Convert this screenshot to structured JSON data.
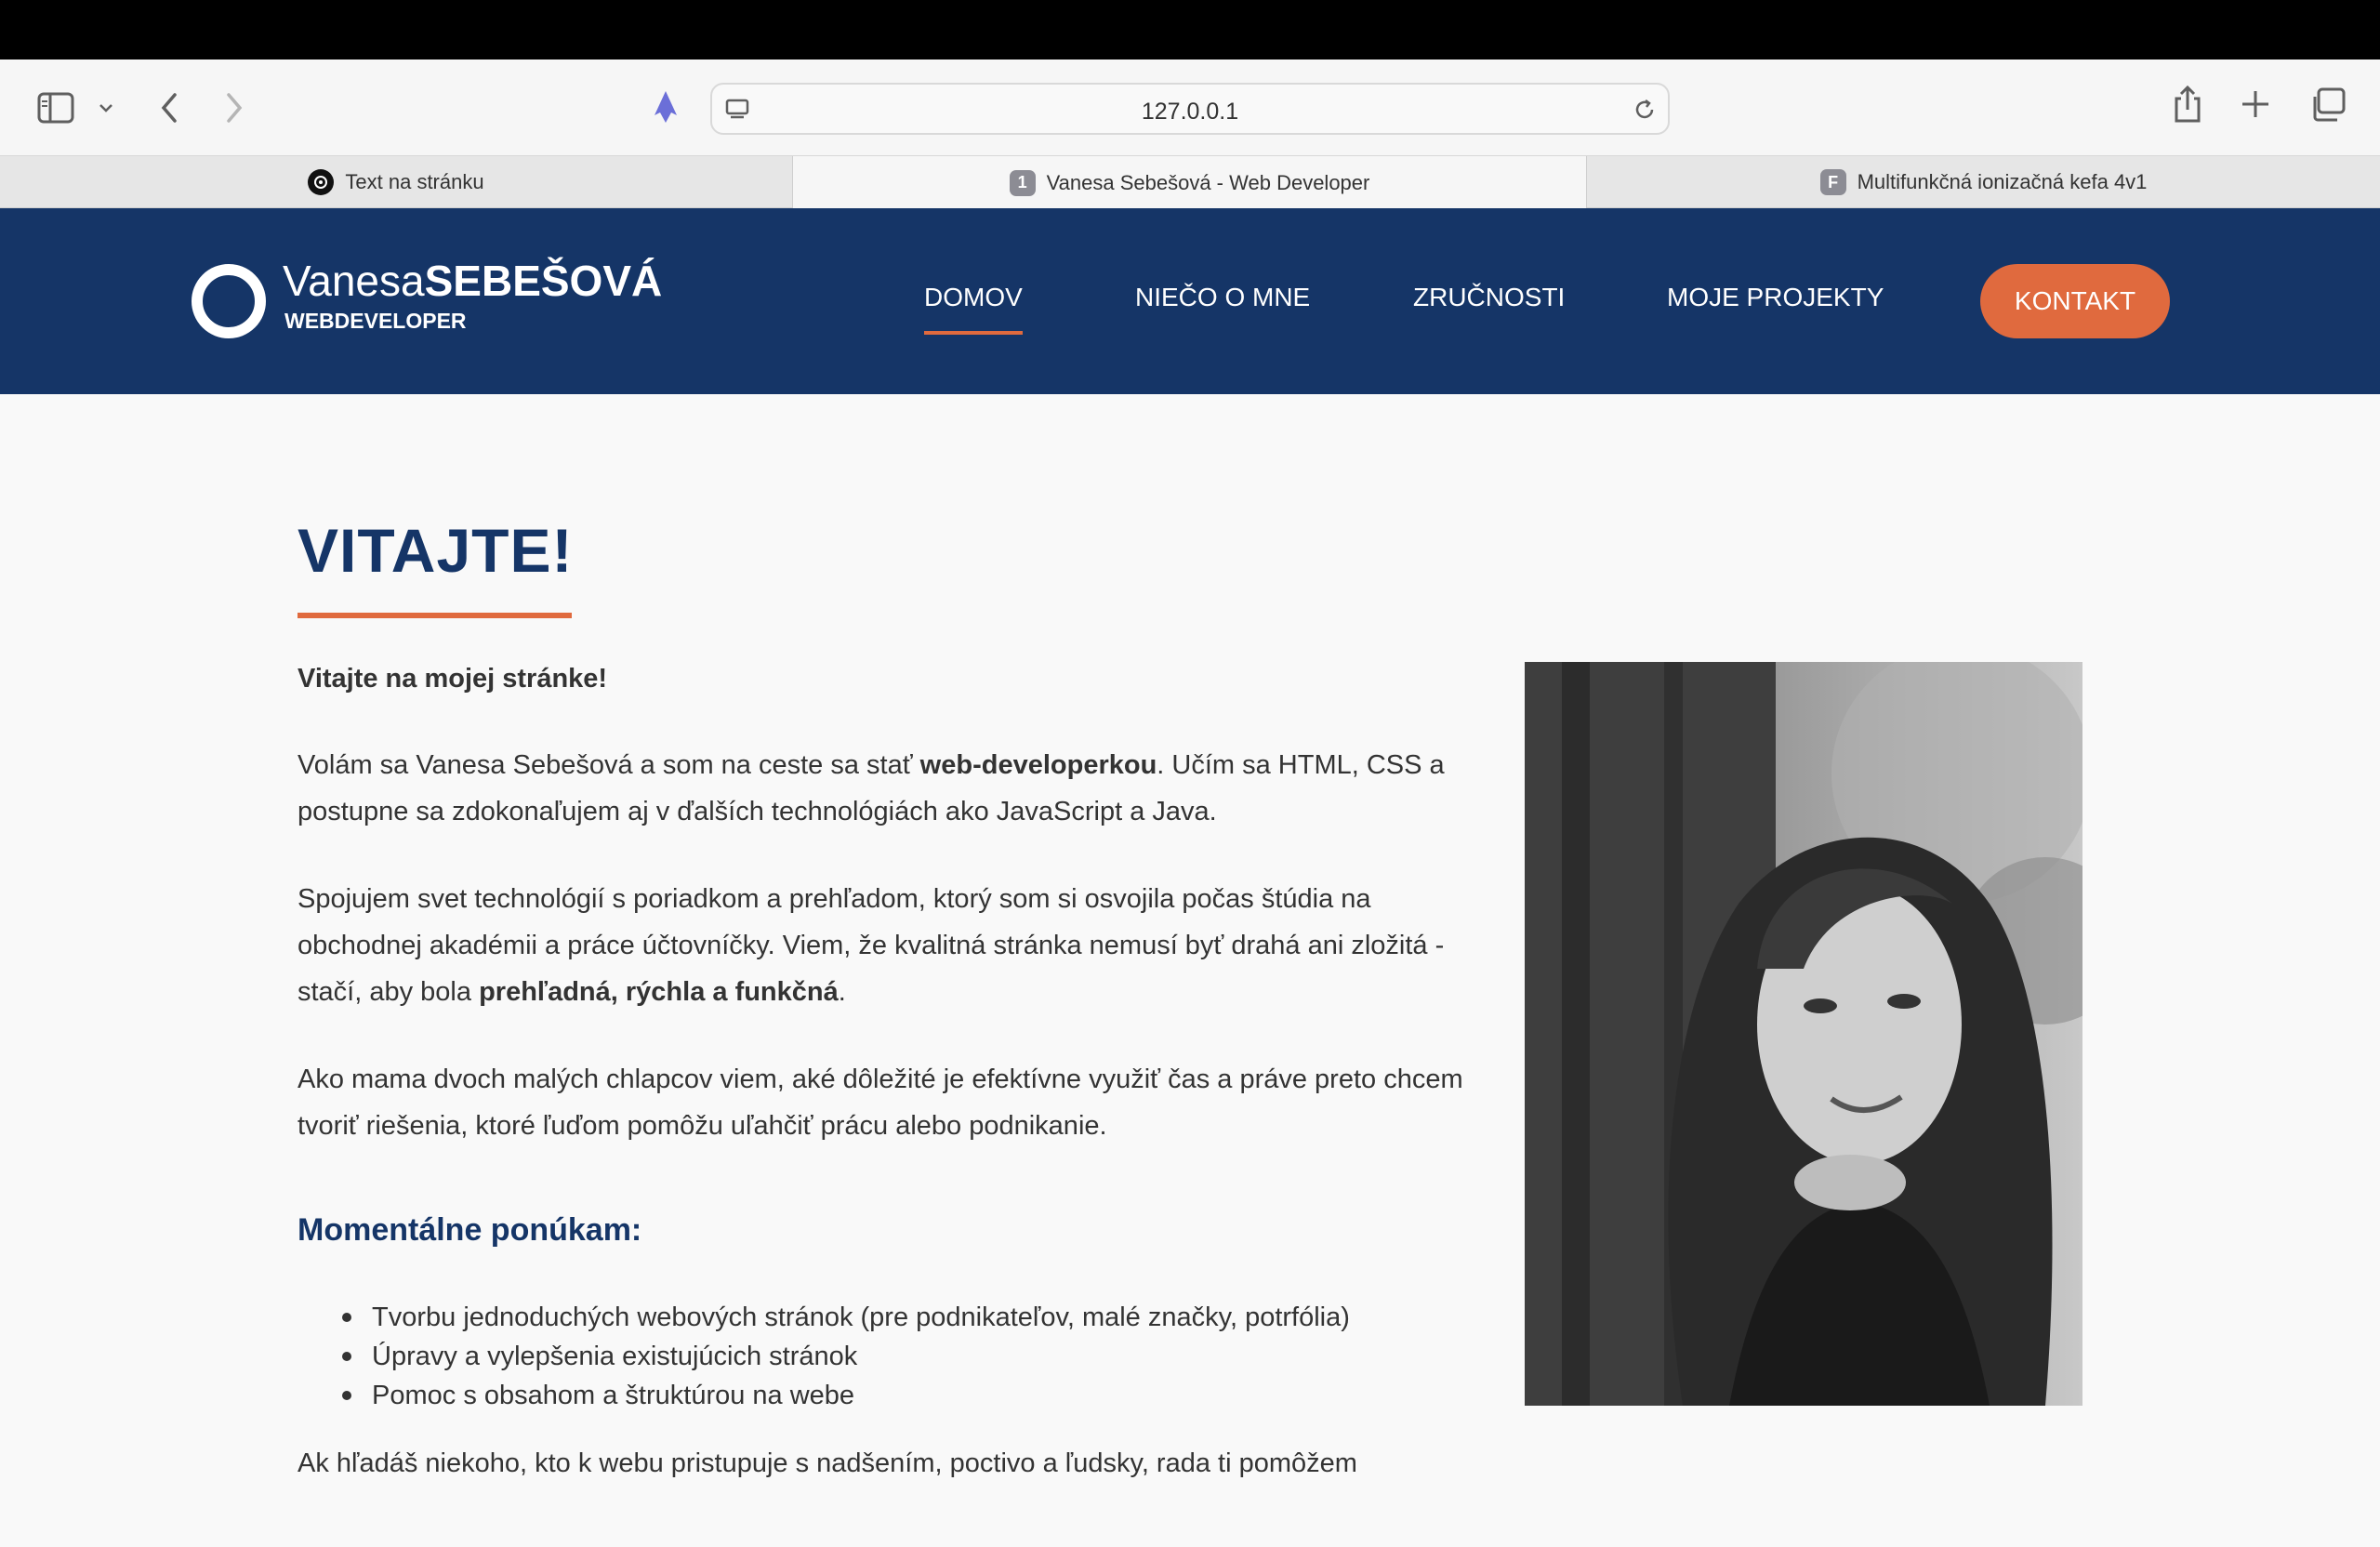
{
  "browser": {
    "url": "127.0.0.1",
    "tabs": [
      {
        "label": "Text na stránku",
        "favicon": "openai-icon"
      },
      {
        "label": "Vanesa Sebešová - Web Developer",
        "favicon_letter": "1"
      },
      {
        "label": "Multifunkčná ionizačná kefa 4v1",
        "favicon_letter": "F"
      }
    ]
  },
  "header": {
    "logo_first": "Vanesa",
    "logo_last": "SEBEŠOVÁ",
    "logo_sub": "WEBDEVELOPER",
    "nav": [
      "DOMOV",
      "NIEČO O MNE",
      "ZRUČNOSTI",
      "MOJE PROJEKTY"
    ],
    "cta": "KONTAKT"
  },
  "main": {
    "title": "VITAJTE!",
    "intro": "Vitajte na mojej stránke!",
    "p1_a": "Volám sa Vanesa Sebešová a som na ceste sa stať ",
    "p1_b": "web-developerkou",
    "p1_c": ". Učím sa HTML, CSS a postupne sa zdokonaľujem aj v ďalších technológiách ako JavaScript a Java.",
    "p2_a": "Spojujem svet technológií s poriadkom a prehľadom, ktorý som si osvojila počas štúdia na obchodnej akadémii a práce účtovníčky. Viem, že kvalitná stránka nemusí byť drahá ani zložitá - stačí, aby bola ",
    "p2_b": "prehľadná, rýchla a funkčná",
    "p2_c": ".",
    "p3": "Ako mama dvoch malých chlapcov viem, aké dôležité je efektívne využiť čas a práve preto chcem tvoriť riešenia, ktoré ľuďom pomôžu uľahčiť prácu alebo podnikanie.",
    "offer_title": "Momentálne ponúkam:",
    "offer": [
      "Tvorbu jednoduchých webových stránok (pre podnikateľov, malé značky, potrfólia)",
      "Úpravy a vylepšenia existujúcich stránok",
      "Pomoc s obsahom a štruktúrou na webe"
    ],
    "closing": "Ak hľadáš niekoho, kto k webu pristupuje s nadšením, poctivo a ľudsky, rada ti pomôžem"
  },
  "colors": {
    "navy": "#153567",
    "accent": "#e06a3e"
  }
}
